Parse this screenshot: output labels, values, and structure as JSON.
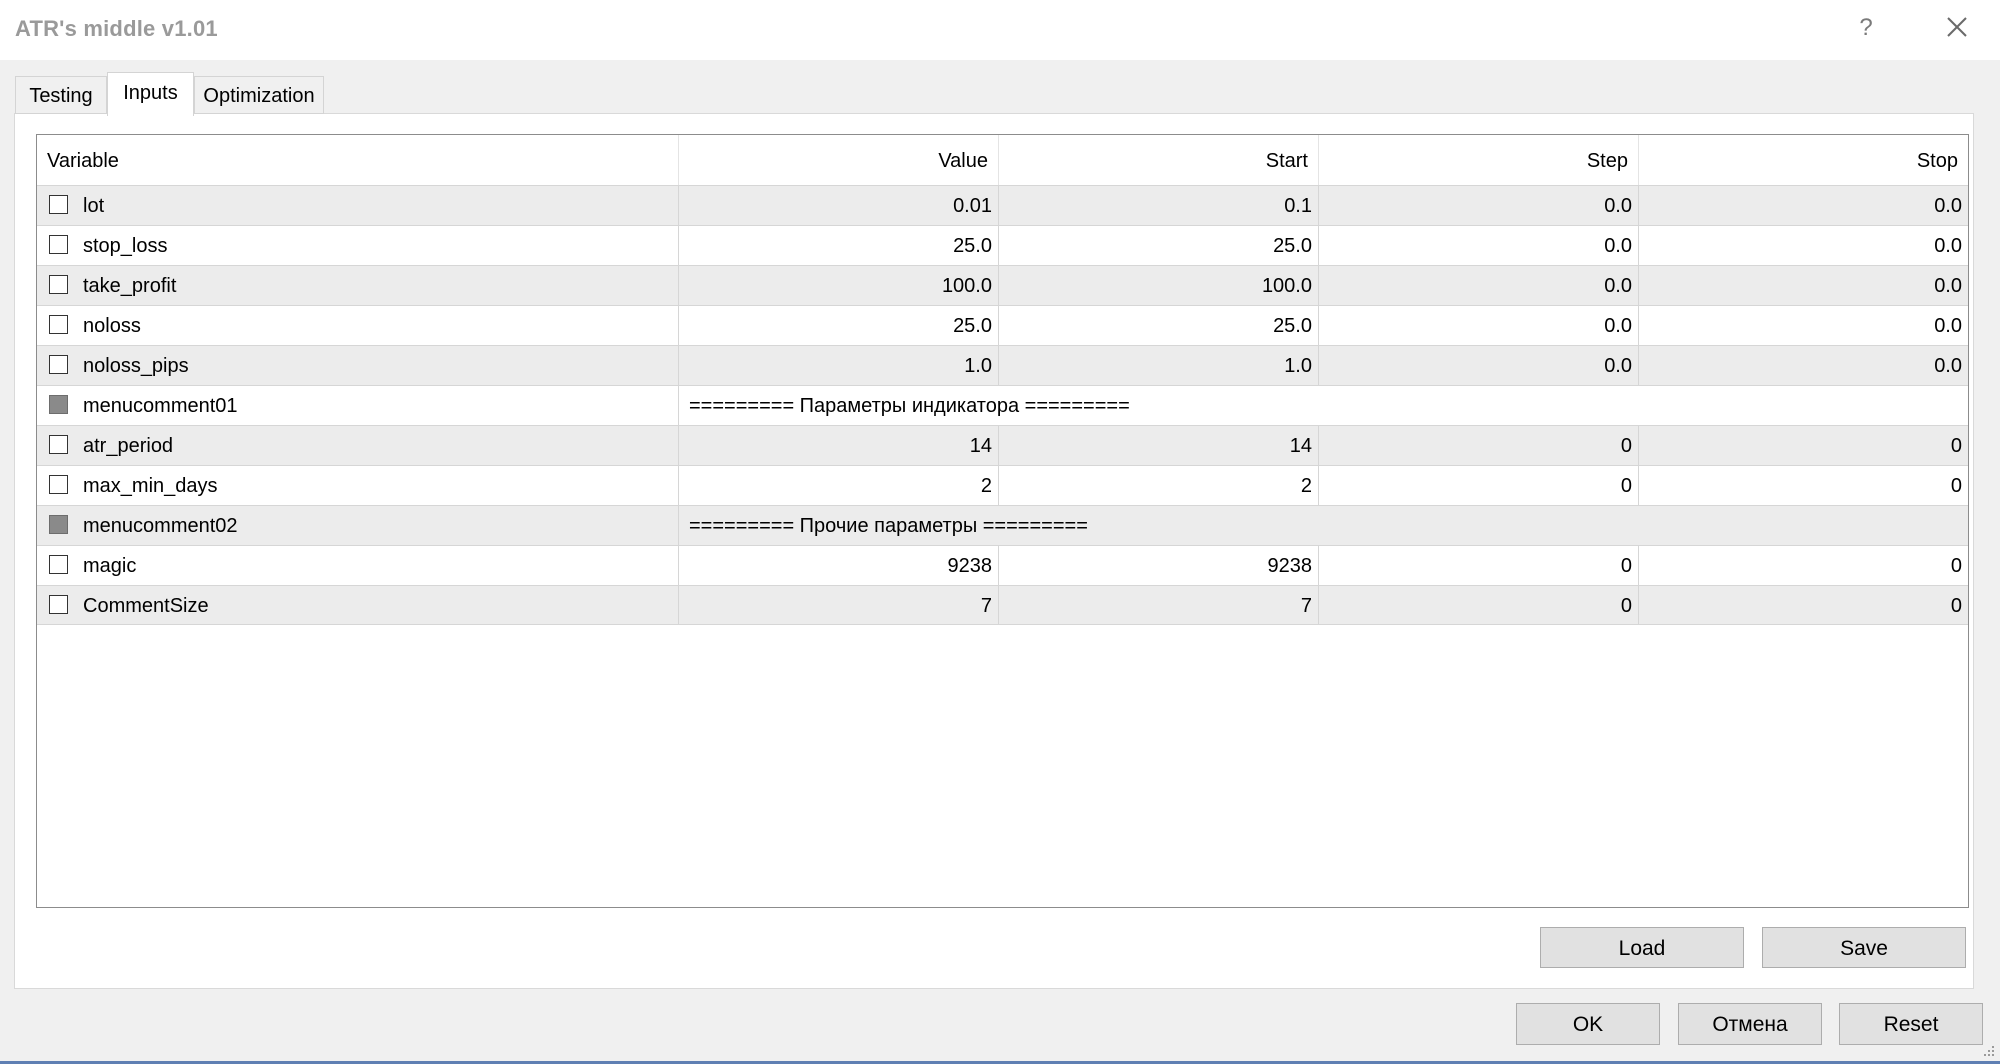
{
  "window": {
    "title": "ATR's middle v1.01",
    "help_label": "?",
    "close_icon": "close-icon"
  },
  "tabs": [
    {
      "label": "Testing",
      "active": false
    },
    {
      "label": "Inputs",
      "active": true
    },
    {
      "label": "Optimization",
      "active": false
    }
  ],
  "table": {
    "columns": [
      "Variable",
      "Value",
      "Start",
      "Step",
      "Stop"
    ],
    "rows": [
      {
        "name": "lot",
        "value": "0.01",
        "start": "0.1",
        "step": "0.0",
        "stop": "0.0",
        "checked": false,
        "type": "param"
      },
      {
        "name": "stop_loss",
        "value": "25.0",
        "start": "25.0",
        "step": "0.0",
        "stop": "0.0",
        "checked": false,
        "type": "param"
      },
      {
        "name": "take_profit",
        "value": "100.0",
        "start": "100.0",
        "step": "0.0",
        "stop": "0.0",
        "checked": false,
        "type": "param"
      },
      {
        "name": "noloss",
        "value": "25.0",
        "start": "25.0",
        "step": "0.0",
        "stop": "0.0",
        "checked": false,
        "type": "param"
      },
      {
        "name": "noloss_pips",
        "value": "1.0",
        "start": "1.0",
        "step": "0.0",
        "stop": "0.0",
        "checked": false,
        "type": "param"
      },
      {
        "name": "menucomment01",
        "comment": "========= Параметры индикатора =========",
        "type": "comment"
      },
      {
        "name": "atr_period",
        "value": "14",
        "start": "14",
        "step": "0",
        "stop": "0",
        "checked": false,
        "type": "param"
      },
      {
        "name": "max_min_days",
        "value": "2",
        "start": "2",
        "step": "0",
        "stop": "0",
        "checked": false,
        "type": "param"
      },
      {
        "name": "menucomment02",
        "comment": "========= Прочие параметры =========",
        "type": "comment"
      },
      {
        "name": "magic",
        "value": "9238",
        "start": "9238",
        "step": "0",
        "stop": "0",
        "checked": false,
        "type": "param"
      },
      {
        "name": "CommentSize",
        "value": "7",
        "start": "7",
        "step": "0",
        "stop": "0",
        "checked": false,
        "type": "param"
      }
    ]
  },
  "buttons": {
    "load": "Load",
    "save": "Save",
    "ok": "OK",
    "cancel": "Отмена",
    "reset": "Reset"
  },
  "colors": {
    "row_shade": "#ececec",
    "disabled_checkbox": "#8a8a8a",
    "bottom_accent": "#5f7fb3"
  }
}
